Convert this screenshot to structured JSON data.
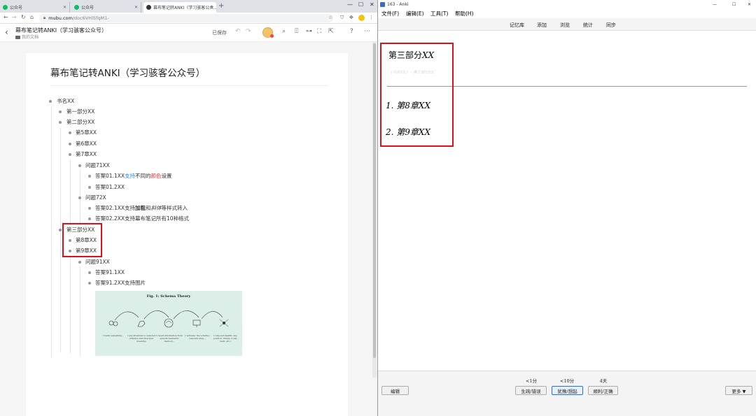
{
  "browser": {
    "tabs": [
      {
        "title": "公众号"
      },
      {
        "title": "公众号"
      },
      {
        "title": "幕布笔记转ANKI（学习骇客公众..."
      }
    ],
    "url_host": "mubu.com",
    "url_path": "/doc6VHl5fqM1-"
  },
  "mubu": {
    "doc_title": "幕布笔记转ANKI（学习骇客公众号）",
    "breadcrumb": "我的文档",
    "save_status": "已保存",
    "heading": "幕布笔记转ANKI（学习骇客公众号）",
    "outline": {
      "book": "书名XX",
      "part1": "第一部分XX",
      "part2": "第二部分XX",
      "ch5": "第5章XX",
      "ch6": "第6章XX",
      "ch7": "第7章XX",
      "q71": "问题71XX",
      "a011_pre": "答案01.1XX",
      "a011_blue": "支持",
      "a011_mid": "不同的",
      "a011_red": "颜色",
      "a011_post": "设置",
      "a012": "答案01.2XX",
      "q72": "问题72X",
      "a021_pre": "答案02.1XX支持",
      "a021_bold": "加粗",
      "a021_mid": "和",
      "a021_ital": "斜体",
      "a021_post": "等样式转入",
      "a022": "答案02.2XX支持幕布笔记所有10种格式",
      "part3": "第三部分XX",
      "ch8": "第8章XX",
      "ch9": "第9章XX",
      "q91": "问题91XX",
      "a911": "答案91.1XX",
      "a912": "答案91.2XX支持图片"
    },
    "figure": {
      "title": "Fig. 1: Schema Theory",
      "captions": [
        "I learn something...",
        "I pay attention to selected stimulus and interpret meaning",
        "I recall information from episodic/semantic memory...",
        "I 'activate' the schema / relevant drag...",
        "I respond (health, say, position, things, looks, back, etc.)"
      ]
    }
  },
  "anki": {
    "window_title": "163 - Anki",
    "menu": [
      "文件(F)",
      "编辑(E)",
      "工具(T)",
      "帮助(H)"
    ],
    "toolbar": [
      "记忆库",
      "添加",
      "浏览",
      "统计",
      "同步"
    ],
    "card": {
      "heading_cn": "第三部分",
      "heading_x": "XX",
      "breadcrumb": "《书名XX》 - 第三部分XX",
      "line1_num": "1.",
      "line1_cn": "第8章",
      "line1_x": "XX",
      "line2_num": "2.",
      "line2_cn": "第9章",
      "line2_x": "XX"
    },
    "timings": [
      "<1分",
      "<10分",
      "4天"
    ],
    "buttons": {
      "edit": "编辑",
      "again": "生疏/错误",
      "hard": "犹豫/想起",
      "good": "顺利/正确",
      "more": "更多 ▼"
    }
  }
}
